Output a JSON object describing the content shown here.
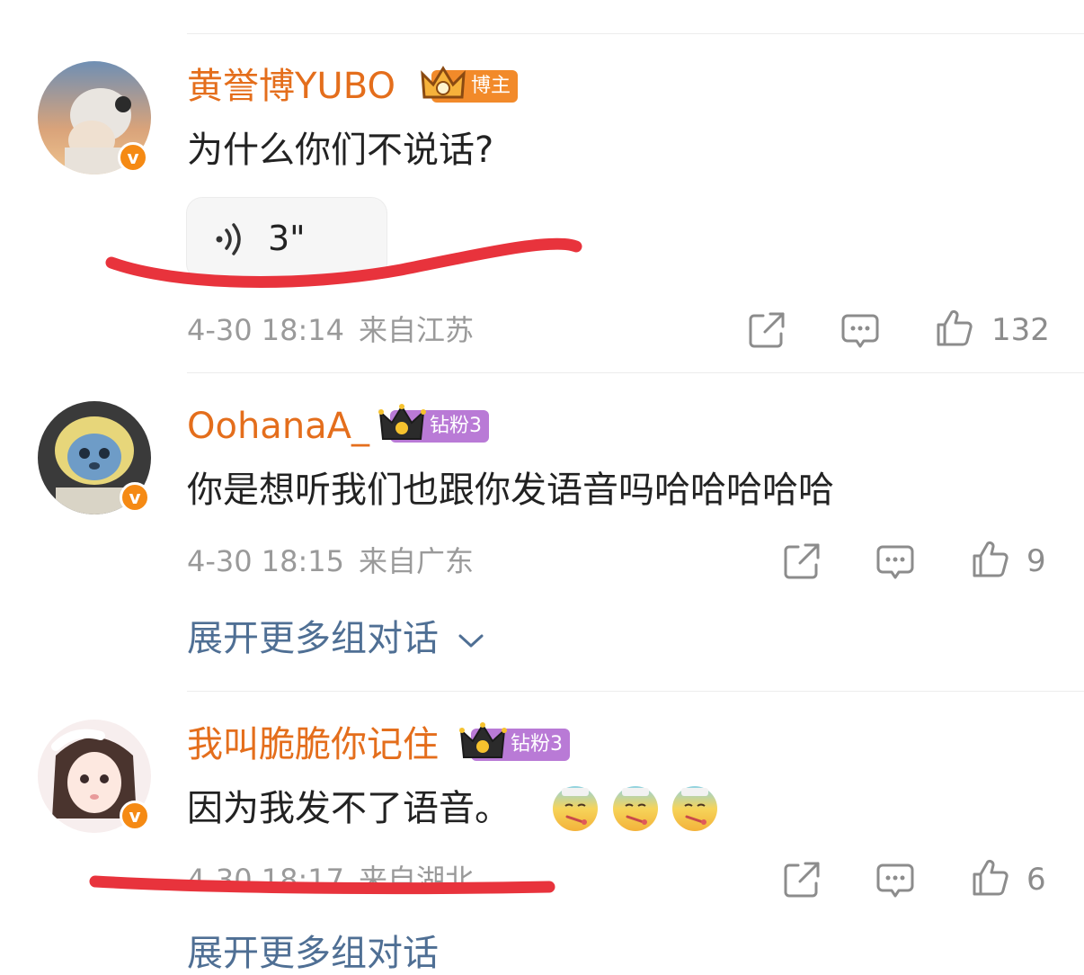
{
  "comments": [
    {
      "username": "黄誉博YUBO",
      "badge": "博主",
      "text": "为什么你们不说话?",
      "voice_duration": "3\"",
      "date": "4-30 18:14",
      "location": "来自江苏",
      "likes": "132"
    },
    {
      "username": "OohanaA_",
      "badge": "钻粉3",
      "text": "你是想听我们也跟你发语音吗哈哈哈哈哈",
      "date": "4-30 18:15",
      "location": "来自广东",
      "likes": "9",
      "expand": "展开更多组对话"
    },
    {
      "username": "我叫脆脆你记住",
      "badge": "钻粉3",
      "text": "因为我发不了语音。",
      "date": "4-30 18:17",
      "location": "来自湖北",
      "likes": "6",
      "expand": "展开更多组对话"
    }
  ],
  "colors": {
    "username": "#e46e1c",
    "meta": "#9a9a9a",
    "link": "#4f6f94",
    "annotation_red": "#e8333c"
  },
  "icons": [
    "share-icon",
    "comment-icon",
    "like-icon",
    "verified-icon",
    "crown-icon",
    "voice-wave-icon",
    "chevron-down-icon"
  ]
}
